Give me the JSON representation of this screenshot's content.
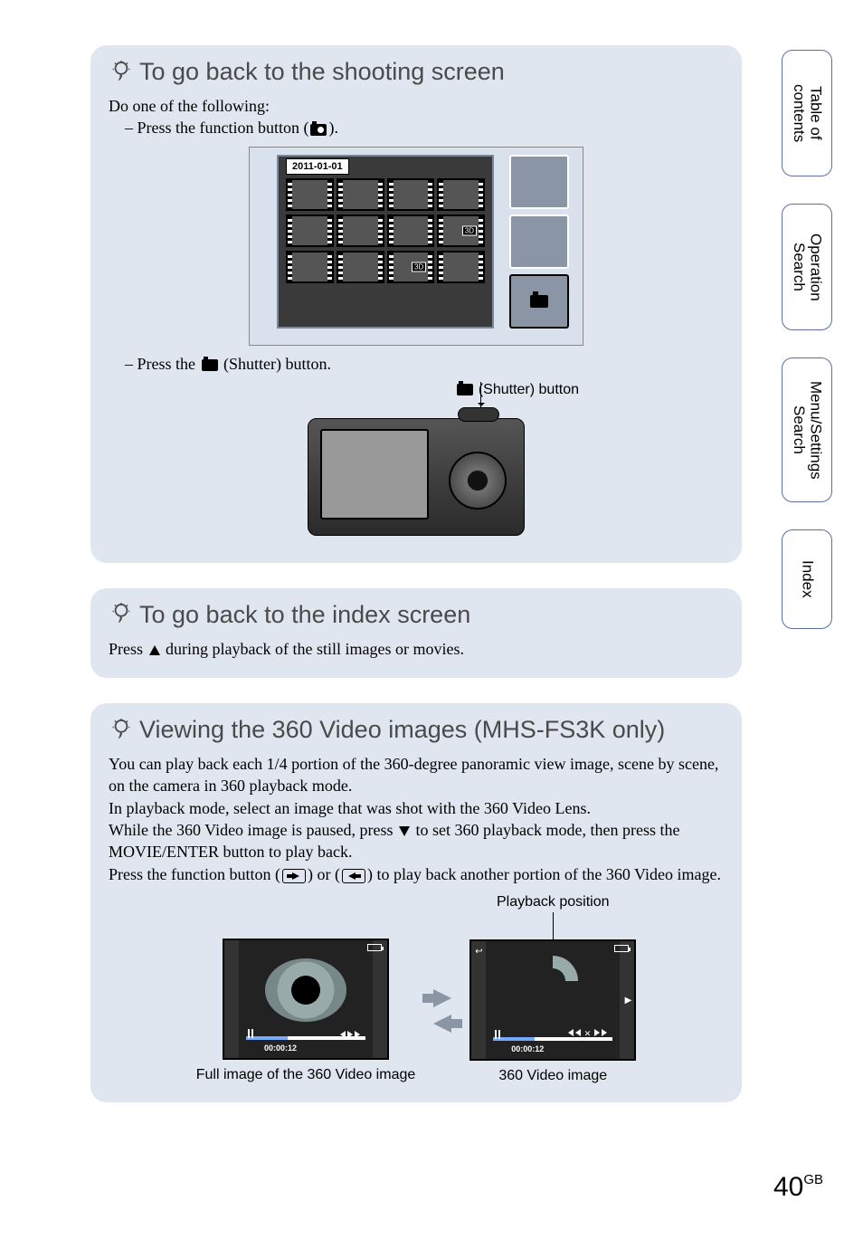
{
  "nav": {
    "toc": "Table of\ncontents",
    "operation": "Operation\nSearch",
    "menu": "Menu/Settings\nSearch",
    "index": "Index"
  },
  "tip1": {
    "title": "To go back to the shooting screen",
    "intro": "Do one of the following:",
    "bullet1_pre": "– Press the function button (",
    "bullet1_post": ").",
    "date_label": "2011-01-01",
    "bullet2_pre": "– Press the ",
    "bullet2_post": " (Shutter) button.",
    "shutter_caption_post": " (Shutter) button"
  },
  "tip2": {
    "title": "To go back to the index screen",
    "body_pre": "Press ",
    "body_post": " during playback of the still images or movies."
  },
  "tip3": {
    "title": "Viewing the 360 Video images (MHS-FS3K only)",
    "p1": "You can play back each 1/4 portion of the 360-degree panoramic view image, scene by scene, on the camera in 360 playback mode.",
    "p2": "In playback mode, select an image that was shot with the 360 Video Lens.",
    "p3_pre": "While the 360 Video image is paused, press ",
    "p3_mid": " to set 360 playback mode, then press the MOVIE/ENTER button to play back.",
    "p4_a": "Press the function button (",
    "p4_b": ") or (",
    "p4_c": ") to play back another portion of the 360 Video image.",
    "playback_position": "Playback position",
    "caption_left": "Full image of the 360 Video image",
    "caption_right": "360 Video image",
    "timecode": "00:00:12"
  },
  "badge3d": "3D",
  "page_number": "40",
  "page_lang": "GB"
}
